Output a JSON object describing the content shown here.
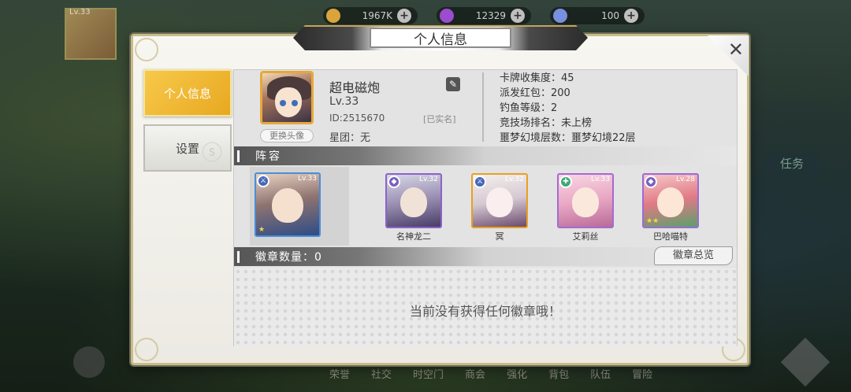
{
  "resources": [
    {
      "name": "gold",
      "value": "1967K",
      "color": "#d9a53a"
    },
    {
      "name": "gems",
      "value": "12329",
      "color": "#9b4ccf"
    },
    {
      "name": "stamina",
      "value": "100",
      "color": "#7a8fe0"
    }
  ],
  "corner_avatar": {
    "level": "Lv.33"
  },
  "dialog": {
    "title": "个人信息",
    "close": "✕"
  },
  "tabs": [
    {
      "label": "个人信息",
      "active": true
    },
    {
      "label": "设置",
      "active": false
    }
  ],
  "profile": {
    "name": "超电磁炮",
    "level": "Lv.33",
    "id": "ID:2515670",
    "verified": "[已实名]",
    "guild": "星团：无",
    "change_avatar": "更换头像"
  },
  "stats": [
    "卡牌收集度：45",
    "派发红包：200",
    "钓鱼等级：2",
    "竞技场排名：未上榜",
    "噩梦幻境层数：噩梦幻境22层"
  ],
  "lineup": {
    "header": "阵容",
    "leader": {
      "level": "Lv.33",
      "stars": 1
    },
    "members": [
      {
        "name": "名神龙二",
        "level": "Lv.32",
        "stars": 0,
        "frame": "#8b63c9"
      },
      {
        "name": "冥",
        "level": "Lv.32",
        "stars": 0,
        "frame": "#e8a020"
      },
      {
        "name": "艾莉丝",
        "level": "Lv.33",
        "stars": 0,
        "frame": "#a56ad0"
      },
      {
        "name": "巴哈喵特",
        "level": "Lv.28",
        "stars": 2,
        "frame": "#9b6bd6"
      }
    ]
  },
  "badges": {
    "header": "徽章数量：0",
    "overview_button": "徽章总览",
    "empty": "当前没有获得任何徽章哦！"
  },
  "background": {
    "mission_label": "任务",
    "bottom_nav": [
      "荣誉",
      "社交",
      "时空门",
      "商会",
      "强化",
      "背包",
      "队伍",
      "冒险"
    ]
  }
}
